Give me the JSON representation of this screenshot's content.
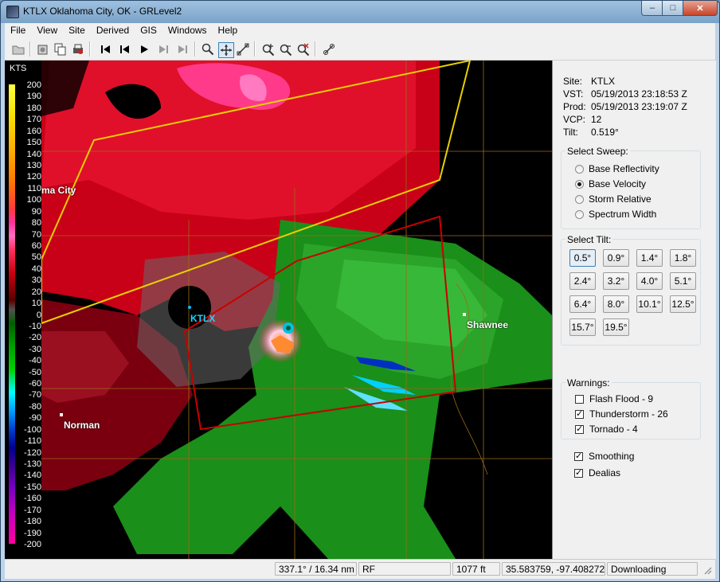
{
  "window": {
    "title": "KTLX Oklahoma City, OK - GRLevel2",
    "controls": {
      "minimize": "–",
      "maximize": "□",
      "close": "✕"
    }
  },
  "menu": [
    "File",
    "View",
    "Site",
    "Derived",
    "GIS",
    "Windows",
    "Help"
  ],
  "toolbar": {
    "icons": [
      "open-folder-icon",
      "copy-image-icon",
      "copy-all-icon",
      "print-icon",
      "skip-first-icon",
      "step-back-icon",
      "play-icon",
      "step-forward-icon",
      "skip-last-icon",
      "zoom-tool-icon",
      "pan-tool-icon",
      "measure-tool-icon",
      "zoom-in-icon",
      "zoom-out-icon",
      "zoom-reset-icon",
      "link-icon"
    ]
  },
  "legend": {
    "title": "KTS",
    "ticks": [
      "200",
      "190",
      "180",
      "170",
      "160",
      "150",
      "140",
      "130",
      "120",
      "110",
      "100",
      "90",
      "80",
      "70",
      "60",
      "50",
      "40",
      "30",
      "20",
      "10",
      "0",
      "-10",
      "-20",
      "-30",
      "-40",
      "-50",
      "-60",
      "-70",
      "-80",
      "-90",
      "-100",
      "-110",
      "-120",
      "-130",
      "-140",
      "-150",
      "-160",
      "-170",
      "-180",
      "-190",
      "-200"
    ]
  },
  "map": {
    "cities": {
      "okc": "ma City",
      "shawnee": "Shawnee",
      "norman": "Norman"
    },
    "radar_label": "KTLX"
  },
  "info": {
    "site_key": "Site:",
    "site_val": "KTLX",
    "vst_key": "VST:",
    "vst_val": "05/19/2013  23:18:53 Z",
    "prod_key": "Prod:",
    "prod_val": "05/19/2013  23:19:07 Z",
    "vcp_key": "VCP:",
    "vcp_val": "12",
    "tilt_key": "Tilt:",
    "tilt_val": "0.519°"
  },
  "sweep": {
    "title": "Select Sweep:",
    "options": [
      "Base Reflectivity",
      "Base Velocity",
      "Storm Relative",
      "Spectrum Width"
    ],
    "selected": "Base Velocity"
  },
  "tilt": {
    "title": "Select Tilt:",
    "buttons": [
      "0.5°",
      "0.9°",
      "1.4°",
      "1.8°",
      "2.4°",
      "3.2°",
      "4.0°",
      "5.1°",
      "6.4°",
      "8.0°",
      "10.1°",
      "12.5°",
      "15.7°",
      "19.5°"
    ],
    "selected": "0.5°"
  },
  "warnings": {
    "title": "Warnings:",
    "items": [
      {
        "label": "Flash Flood - 9",
        "checked": false
      },
      {
        "label": "Thunderstorm - 26",
        "checked": true
      },
      {
        "label": "Tornado - 4",
        "checked": true
      }
    ]
  },
  "options": {
    "smoothing": {
      "label": "Smoothing",
      "checked": true
    },
    "dealias": {
      "label": "Dealias",
      "checked": true
    }
  },
  "status": {
    "bearing": "337.1° / 16.34 nm",
    "code": "RF",
    "height": "1077 ft",
    "coords": "35.583759, -97.408272",
    "state": "Downloading"
  },
  "colors": {
    "tornado_warning": "#c80000",
    "thunderstorm_warning": "#e8d000",
    "radar_label": "#1ad4ff"
  }
}
